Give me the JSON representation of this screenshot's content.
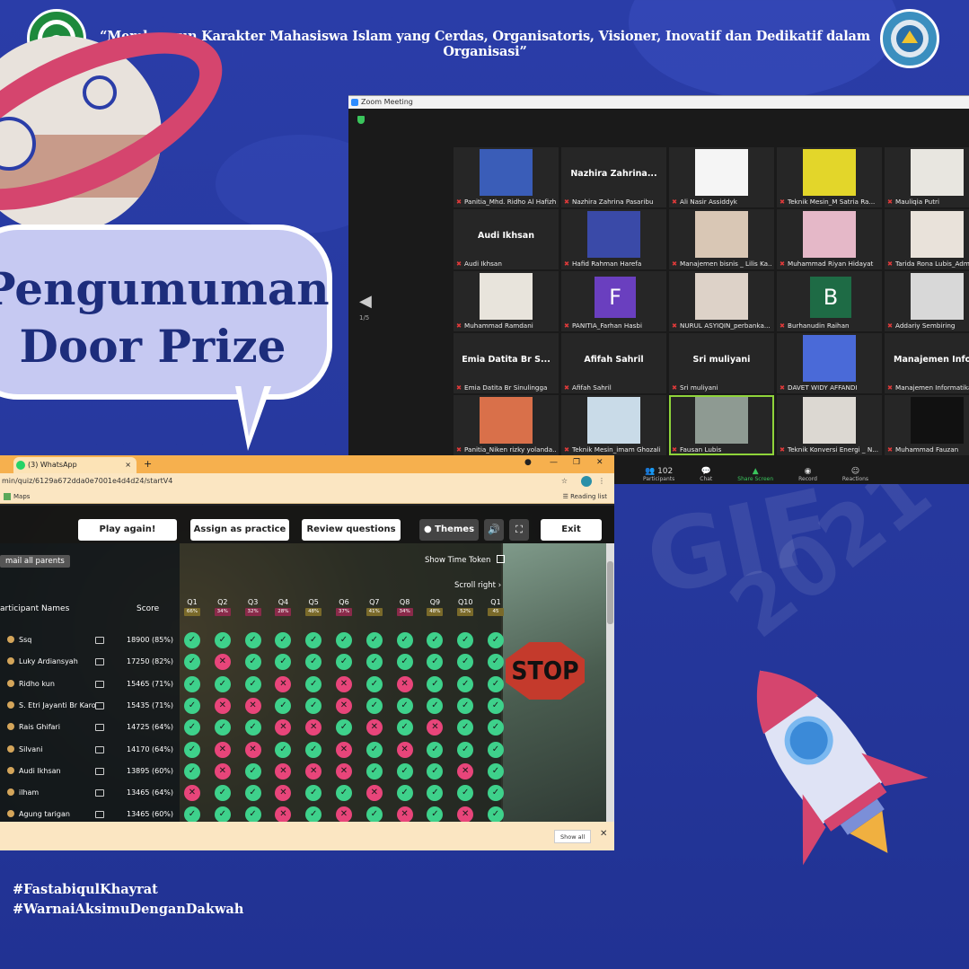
{
  "header": {
    "tagline": "“Membangun Karakter Mahasiswa Islam yang Cerdas, Organisatoris, Visioner, Inovatif dan Dedikatif dalam Organisasi”"
  },
  "bubble": {
    "line1": "Pengumuman",
    "line2": "Door Prize"
  },
  "watermark": {
    "a": "GIF",
    "b": "2021"
  },
  "zoom": {
    "title": "Zoom Meeting",
    "page": "1/5",
    "tiles": [
      {
        "label": "Panitia_Mhd. Ridho Al Hafizh",
        "big": "",
        "avatar": "",
        "color": "#3a5db8"
      },
      {
        "label": "Nazhira Zahrina Pasaribu",
        "big": "Nazhira  Zahrina...",
        "avatar": "",
        "color": ""
      },
      {
        "label": "Ali Nasir Assiddyk",
        "big": "",
        "avatar": "",
        "color": "#f5f5f5"
      },
      {
        "label": "Teknik Mesin_M Satria Ra...",
        "big": "",
        "avatar": "",
        "color": "#e3d62a"
      },
      {
        "label": "Mauliqia Putri",
        "big": "",
        "avatar": "",
        "color": "#e8e6e0"
      },
      {
        "label": "Audi Ikhsan",
        "big": "Audi Ikhsan",
        "avatar": "",
        "color": ""
      },
      {
        "label": "Hafid Rahman Harefa",
        "big": "",
        "avatar": "",
        "color": "#3a4aa8"
      },
      {
        "label": "Manajemen bisnis _ Lilis Ka...",
        "big": "",
        "avatar": "",
        "color": "#d9c7b5"
      },
      {
        "label": "Muhammad Riyan Hidayat",
        "big": "",
        "avatar": "",
        "color": "#e5b8c8"
      },
      {
        "label": "Tarida Rona Lubis_Adm",
        "big": "",
        "avatar": "",
        "color": "#e9e2da"
      },
      {
        "label": "Muhammad Ramdani",
        "big": "",
        "avatar": "",
        "color": "#e8e4dc"
      },
      {
        "label": "PANITIA_Farhan Hasbi",
        "big": "",
        "avatar": "F",
        "color": "#6a3fbf"
      },
      {
        "label": "NURUL ASYIQIN_perbanka...",
        "big": "",
        "avatar": "",
        "color": "#ddd2c8"
      },
      {
        "label": "Burhanudin Raihan",
        "big": "",
        "avatar": "B",
        "color": "#1e6b45"
      },
      {
        "label": "Addariy Sembiring",
        "big": "",
        "avatar": "",
        "color": "#d8d8d8"
      },
      {
        "label": "Emia Datita Br Sinulingga",
        "big": "Emia Datita Br S...",
        "avatar": "",
        "color": ""
      },
      {
        "label": "Afifah Sahril",
        "big": "Afifah Sahril",
        "avatar": "",
        "color": ""
      },
      {
        "label": "Sri muliyani",
        "big": "Sri muliyani",
        "avatar": "",
        "color": ""
      },
      {
        "label": "DAVET WIDY AFFANDI",
        "big": "",
        "avatar": "",
        "color": "#4a6ad8"
      },
      {
        "label": "Manajemen Informatika",
        "big": "Manajemen  Info...",
        "avatar": "",
        "color": ""
      },
      {
        "label": "Panitia_Niken rizky yolanda...",
        "big": "",
        "avatar": "",
        "color": "#d9704a"
      },
      {
        "label": "Teknik Mesin_imam Ghozali",
        "big": "",
        "avatar": "",
        "color": "#c9dbe8"
      },
      {
        "label": "Fausan Lubis",
        "big": "",
        "avatar": "",
        "color": "#8e9a92"
      },
      {
        "label": "Teknik Konversi Energi _ N...",
        "big": "",
        "avatar": "",
        "color": "#dcd8d2"
      },
      {
        "label": "Muhammad Fauzan",
        "big": "",
        "avatar": "",
        "color": "#111111"
      }
    ],
    "bar": {
      "participants_count": "102",
      "participants": "Participants",
      "chat": "Chat",
      "share": "Share Screen",
      "record": "Record",
      "reactions": "Reactions"
    }
  },
  "browser": {
    "tab_title": "(3) WhatsApp",
    "tab_close": "×",
    "new_tab": "+",
    "url": "min/quiz/6129a672dda0e7001e4d4d24/startV4",
    "bookmark": "Maps",
    "reading_list": "Reading list",
    "show_all": "Show all"
  },
  "quiz": {
    "buttons": {
      "play_again": "Play again!",
      "assign": "Assign as practice",
      "review": "Review questions",
      "themes": "Themes",
      "exit": "Exit"
    },
    "email_all": "mail all parents",
    "show_time_token": "Show Time Token",
    "scroll_right": "Scroll right",
    "col_names": "articipant Names",
    "col_score": "Score",
    "questions": [
      {
        "q": "Q1",
        "pct": "66%",
        "color": "#7a6a2a"
      },
      {
        "q": "Q2",
        "pct": "34%",
        "color": "#8a2a4a"
      },
      {
        "q": "Q3",
        "pct": "32%",
        "color": "#8a2a4a"
      },
      {
        "q": "Q4",
        "pct": "28%",
        "color": "#8a2a4a"
      },
      {
        "q": "Q5",
        "pct": "48%",
        "color": "#7a6a2a"
      },
      {
        "q": "Q6",
        "pct": "37%",
        "color": "#8a2a4a"
      },
      {
        "q": "Q7",
        "pct": "41%",
        "color": "#7a6a2a"
      },
      {
        "q": "Q8",
        "pct": "34%",
        "color": "#8a2a4a"
      },
      {
        "q": "Q9",
        "pct": "48%",
        "color": "#7a6a2a"
      },
      {
        "q": "Q10",
        "pct": "52%",
        "color": "#7a6a2a"
      },
      {
        "q": "Q1",
        "pct": "45",
        "color": "#7a6a2a"
      }
    ],
    "participants": [
      {
        "name": "Ssq",
        "score": "18900 (85%)",
        "marks": "11111111111"
      },
      {
        "name": "Luky Ardiansyah",
        "score": "17250 (82%)",
        "marks": "10111111111"
      },
      {
        "name": "Ridho kun",
        "score": "15465 (71%)",
        "marks": "11101010111"
      },
      {
        "name": "S. Etri Jayanti Br Karo",
        "score": "15435 (71%)",
        "marks": "10011011111"
      },
      {
        "name": "Rais Ghifari",
        "score": "14725 (64%)",
        "marks": "11100101011"
      },
      {
        "name": "Silvani",
        "score": "14170 (64%)",
        "marks": "10011010111"
      },
      {
        "name": "Audi Ikhsan",
        "score": "13895 (60%)",
        "marks": "10100011101"
      },
      {
        "name": "ilham",
        "score": "13465 (64%)",
        "marks": "01101101111"
      },
      {
        "name": "Agung tarigan",
        "score": "13465 (60%)",
        "marks": "11101010101"
      }
    ]
  },
  "hashtags": {
    "one": "#FastabiqulKhayrat",
    "two": "#WarnaiAksimuDenganDakwah"
  }
}
